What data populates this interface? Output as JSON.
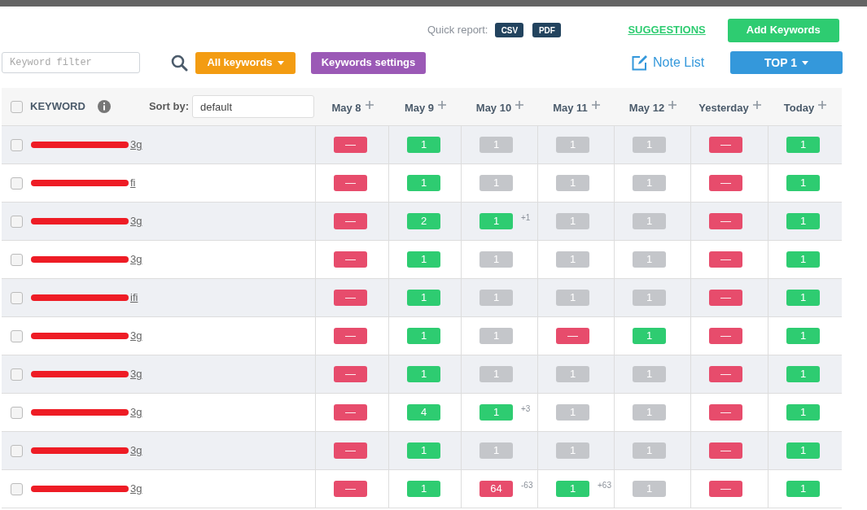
{
  "quick_report": {
    "label": "Quick report:",
    "buttons": [
      "CSV",
      "PDF"
    ]
  },
  "suggestions_link": "SUGGESTIONS",
  "add_button": "Add Keywords",
  "filter": {
    "placeholder": "Keyword filter"
  },
  "all_keywords_button": "All keywords",
  "settings_button": "Keywords settings",
  "note_link": "Note List",
  "top_button": "TOP 1",
  "table": {
    "keyword_header": "KEYWORD",
    "all_checked": false,
    "sort_label": "Sort by:",
    "sort_value": "default",
    "columns": [
      "May 8",
      "May 9",
      "May 10",
      "May 11",
      "May 12",
      "Yesterday",
      "Today"
    ],
    "rows": [
      {
        "keyword": "3g",
        "redacted": true,
        "checked": false,
        "cells": [
          {
            "value": "—",
            "color": "#e74c6c"
          },
          {
            "value": "1",
            "color": "#2ecc71"
          },
          {
            "value": "1",
            "color": "#c4c6ca"
          },
          {
            "value": "1",
            "color": "#c4c6ca"
          },
          {
            "value": "1",
            "color": "#c4c6ca"
          },
          {
            "value": "—",
            "color": "#e74c6c"
          },
          {
            "value": "1",
            "color": "#2ecc71"
          }
        ]
      },
      {
        "keyword": "fi",
        "redacted": true,
        "checked": false,
        "cells": [
          {
            "value": "—",
            "color": "#e74c6c"
          },
          {
            "value": "1",
            "color": "#2ecc71"
          },
          {
            "value": "1",
            "color": "#c4c6ca"
          },
          {
            "value": "1",
            "color": "#c4c6ca"
          },
          {
            "value": "1",
            "color": "#c4c6ca"
          },
          {
            "value": "—",
            "color": "#e74c6c"
          },
          {
            "value": "1",
            "color": "#2ecc71"
          }
        ]
      },
      {
        "keyword": "3g",
        "redacted": true,
        "checked": false,
        "cells": [
          {
            "value": "—",
            "color": "#e74c6c"
          },
          {
            "value": "2",
            "color": "#2ecc71"
          },
          {
            "value": "1",
            "color": "#2ecc71",
            "change": "+1"
          },
          {
            "value": "1",
            "color": "#c4c6ca"
          },
          {
            "value": "1",
            "color": "#c4c6ca"
          },
          {
            "value": "—",
            "color": "#e74c6c"
          },
          {
            "value": "1",
            "color": "#2ecc71"
          }
        ]
      },
      {
        "keyword": "3g",
        "redacted": true,
        "checked": false,
        "cells": [
          {
            "value": "—",
            "color": "#e74c6c"
          },
          {
            "value": "1",
            "color": "#2ecc71"
          },
          {
            "value": "1",
            "color": "#c4c6ca"
          },
          {
            "value": "1",
            "color": "#c4c6ca"
          },
          {
            "value": "1",
            "color": "#c4c6ca"
          },
          {
            "value": "—",
            "color": "#e74c6c"
          },
          {
            "value": "1",
            "color": "#2ecc71"
          }
        ]
      },
      {
        "keyword": "ifi",
        "redacted": true,
        "checked": false,
        "cells": [
          {
            "value": "—",
            "color": "#e74c6c"
          },
          {
            "value": "1",
            "color": "#2ecc71"
          },
          {
            "value": "1",
            "color": "#c4c6ca"
          },
          {
            "value": "1",
            "color": "#c4c6ca"
          },
          {
            "value": "1",
            "color": "#c4c6ca"
          },
          {
            "value": "—",
            "color": "#e74c6c"
          },
          {
            "value": "1",
            "color": "#2ecc71"
          }
        ]
      },
      {
        "keyword": "3g",
        "redacted": true,
        "checked": false,
        "cells": [
          {
            "value": "—",
            "color": "#e74c6c"
          },
          {
            "value": "1",
            "color": "#2ecc71"
          },
          {
            "value": "1",
            "color": "#c4c6ca"
          },
          {
            "value": "—",
            "color": "#e74c6c"
          },
          {
            "value": "1",
            "color": "#2ecc71"
          },
          {
            "value": "—",
            "color": "#e74c6c"
          },
          {
            "value": "1",
            "color": "#2ecc71"
          }
        ]
      },
      {
        "keyword": "3g",
        "redacted": true,
        "checked": false,
        "cells": [
          {
            "value": "—",
            "color": "#e74c6c"
          },
          {
            "value": "1",
            "color": "#2ecc71"
          },
          {
            "value": "1",
            "color": "#c4c6ca"
          },
          {
            "value": "1",
            "color": "#c4c6ca"
          },
          {
            "value": "1",
            "color": "#c4c6ca"
          },
          {
            "value": "—",
            "color": "#e74c6c"
          },
          {
            "value": "1",
            "color": "#2ecc71"
          }
        ]
      },
      {
        "keyword": "3g",
        "redacted": true,
        "checked": false,
        "cells": [
          {
            "value": "—",
            "color": "#e74c6c"
          },
          {
            "value": "4",
            "color": "#2ecc71"
          },
          {
            "value": "1",
            "color": "#2ecc71",
            "change": "+3"
          },
          {
            "value": "1",
            "color": "#c4c6ca"
          },
          {
            "value": "1",
            "color": "#c4c6ca"
          },
          {
            "value": "—",
            "color": "#e74c6c"
          },
          {
            "value": "1",
            "color": "#2ecc71"
          }
        ]
      },
      {
        "keyword": "3g",
        "redacted": true,
        "checked": false,
        "cells": [
          {
            "value": "—",
            "color": "#e74c6c"
          },
          {
            "value": "1",
            "color": "#2ecc71"
          },
          {
            "value": "1",
            "color": "#c4c6ca"
          },
          {
            "value": "1",
            "color": "#c4c6ca"
          },
          {
            "value": "1",
            "color": "#c4c6ca"
          },
          {
            "value": "—",
            "color": "#e74c6c"
          },
          {
            "value": "1",
            "color": "#2ecc71"
          }
        ]
      },
      {
        "keyword": "3g",
        "redacted": true,
        "checked": false,
        "cells": [
          {
            "value": "—",
            "color": "#e74c6c"
          },
          {
            "value": "1",
            "color": "#2ecc71"
          },
          {
            "value": "64",
            "color": "#e74c6c",
            "change": "-63"
          },
          {
            "value": "1",
            "color": "#2ecc71",
            "change": "+63"
          },
          {
            "value": "1",
            "color": "#c4c6ca"
          },
          {
            "value": "—",
            "color": "#e74c6c"
          },
          {
            "value": "1",
            "color": "#2ecc71"
          }
        ]
      }
    ]
  }
}
